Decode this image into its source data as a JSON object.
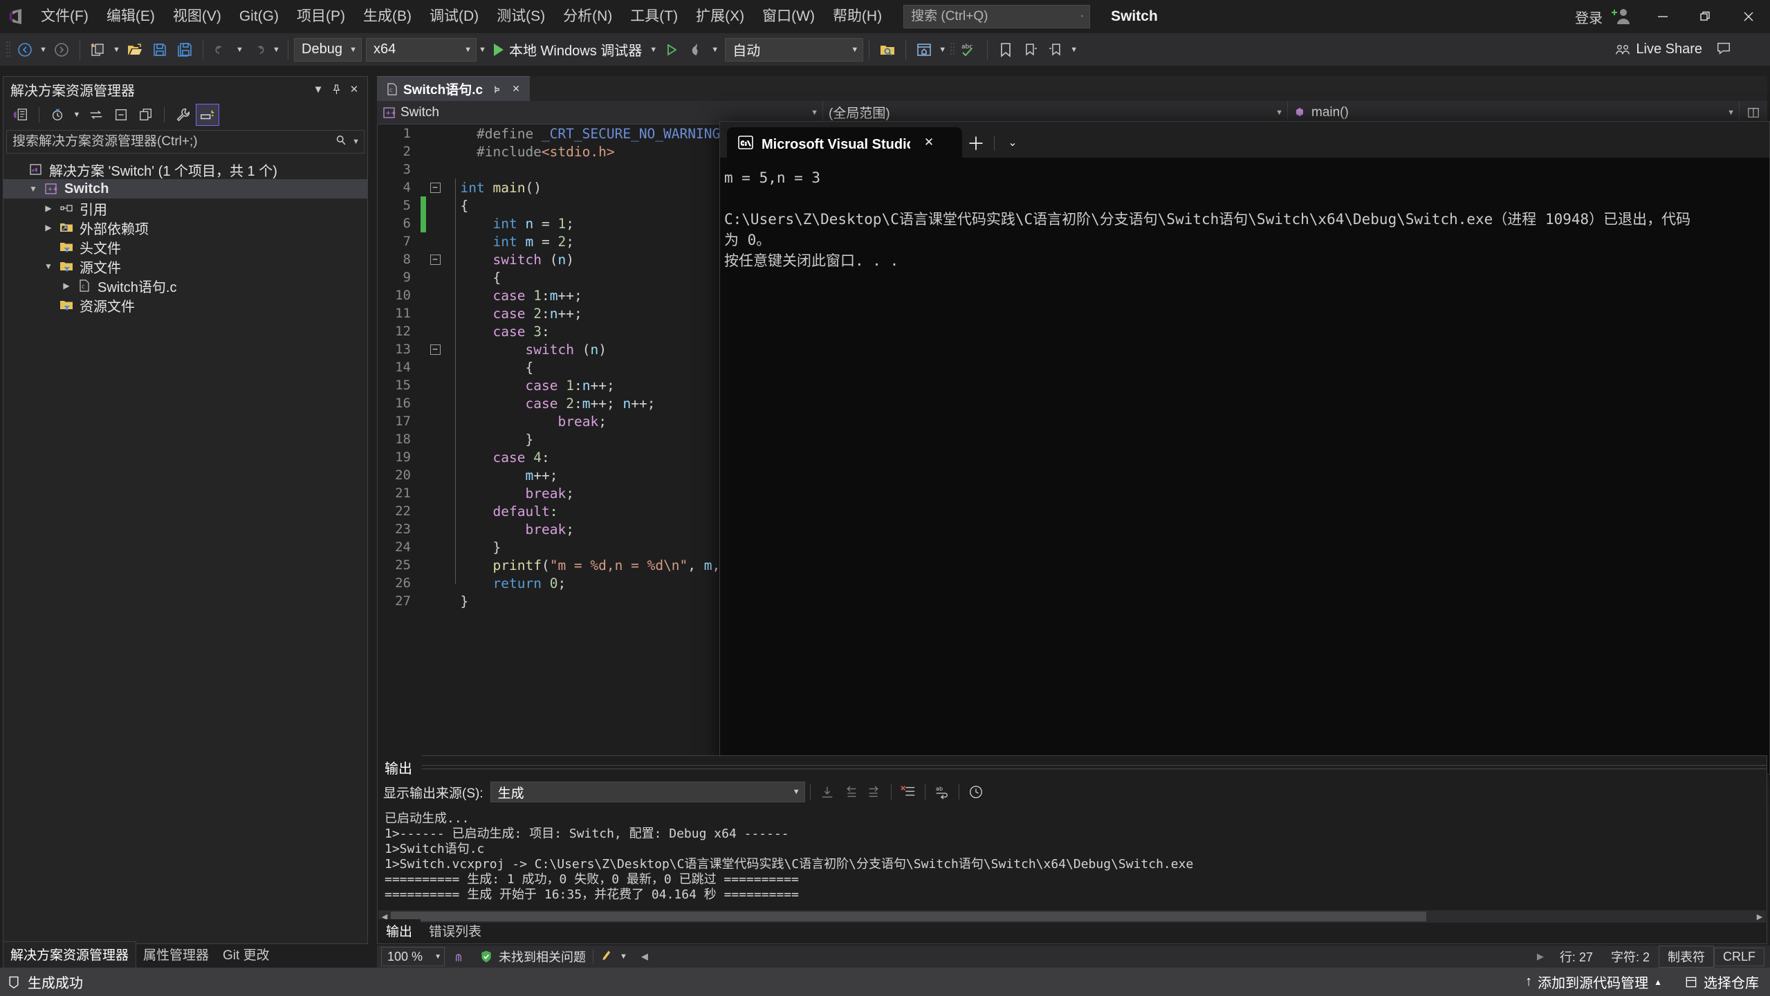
{
  "titlebar": {
    "menus": [
      "文件(F)",
      "编辑(E)",
      "视图(V)",
      "Git(G)",
      "项目(P)",
      "生成(B)",
      "调试(D)",
      "测试(S)",
      "分析(N)",
      "工具(T)",
      "扩展(X)",
      "窗口(W)",
      "帮助(H)"
    ],
    "search_placeholder": "搜索 (Ctrl+Q)",
    "solution_name": "Switch",
    "signin_label": "登录",
    "minimize": "—",
    "maximize": "❐",
    "close": "✕"
  },
  "toolbar": {
    "configuration": "Debug",
    "platform": "x64",
    "run_label": "本地 Windows 调试器",
    "auto_label": "自动",
    "live_share": "Live Share"
  },
  "solution_explorer": {
    "title": "解决方案资源管理器",
    "search_placeholder": "搜索解决方案资源管理器(Ctrl+;)",
    "tree": [
      {
        "label": "解决方案 'Switch' (1 个项目，共 1 个)",
        "indent": 0,
        "twisty": "",
        "icon": "solution-icon",
        "bold": false,
        "selected": false
      },
      {
        "label": "Switch",
        "indent": 1,
        "twisty": "▼",
        "icon": "cpp-project-icon",
        "bold": true,
        "selected": true
      },
      {
        "label": "引用",
        "indent": 2,
        "twisty": "▶",
        "icon": "references-icon",
        "bold": false,
        "selected": false
      },
      {
        "label": "外部依赖项",
        "indent": 2,
        "twisty": "▶",
        "icon": "external-deps-icon",
        "bold": false,
        "selected": false
      },
      {
        "label": "头文件",
        "indent": 2,
        "twisty": "",
        "icon": "filter-folder-icon",
        "bold": false,
        "selected": false
      },
      {
        "label": "源文件",
        "indent": 2,
        "twisty": "▼",
        "icon": "filter-folder-icon",
        "bold": false,
        "selected": false
      },
      {
        "label": "Switch语句.c",
        "indent": 3,
        "twisty": "▶",
        "icon": "c-file-icon",
        "bold": false,
        "selected": false
      },
      {
        "label": "资源文件",
        "indent": 2,
        "twisty": "",
        "icon": "filter-folder-icon",
        "bold": false,
        "selected": false
      }
    ],
    "bottom_tabs": [
      {
        "label": "解决方案资源管理器",
        "active": true
      },
      {
        "label": "属性管理器",
        "active": false
      },
      {
        "label": "Git 更改",
        "active": false
      }
    ]
  },
  "editor": {
    "tab_label": "Switch语句.c",
    "nav_project": "Switch",
    "nav_scope": "(全局范围)",
    "nav_member": "main()",
    "lines": [
      {
        "n": 1,
        "fold": "",
        "mark": "",
        "text": "    #define _CRT_SECURE_NO_WARNINGS"
      },
      {
        "n": 2,
        "fold": "",
        "mark": "",
        "text": "    #include<stdio.h>"
      },
      {
        "n": 3,
        "fold": "",
        "mark": "",
        "text": ""
      },
      {
        "n": 4,
        "fold": "-",
        "mark": "",
        "text": "  int main()"
      },
      {
        "n": 5,
        "fold": "",
        "mark": "green",
        "text": "  {"
      },
      {
        "n": 6,
        "fold": "",
        "mark": "green",
        "text": "      int n = 1;"
      },
      {
        "n": 7,
        "fold": "",
        "mark": "",
        "text": "      int m = 2;"
      },
      {
        "n": 8,
        "fold": "-",
        "mark": "",
        "text": "      switch (n)"
      },
      {
        "n": 9,
        "fold": "",
        "mark": "",
        "text": "      {"
      },
      {
        "n": 10,
        "fold": "",
        "mark": "",
        "text": "      case 1:m++;"
      },
      {
        "n": 11,
        "fold": "",
        "mark": "",
        "text": "      case 2:n++;"
      },
      {
        "n": 12,
        "fold": "",
        "mark": "",
        "text": "      case 3:"
      },
      {
        "n": 13,
        "fold": "-",
        "mark": "",
        "text": "          switch (n)"
      },
      {
        "n": 14,
        "fold": "",
        "mark": "",
        "text": "          {"
      },
      {
        "n": 15,
        "fold": "",
        "mark": "",
        "text": "          case 1:n++;"
      },
      {
        "n": 16,
        "fold": "",
        "mark": "",
        "text": "          case 2:m++; n++;"
      },
      {
        "n": 17,
        "fold": "",
        "mark": "",
        "text": "              break;"
      },
      {
        "n": 18,
        "fold": "",
        "mark": "",
        "text": "          }"
      },
      {
        "n": 19,
        "fold": "",
        "mark": "",
        "text": "      case 4:"
      },
      {
        "n": 20,
        "fold": "",
        "mark": "",
        "text": "          m++;"
      },
      {
        "n": 21,
        "fold": "",
        "mark": "",
        "text": "          break;"
      },
      {
        "n": 22,
        "fold": "",
        "mark": "",
        "text": "      default:"
      },
      {
        "n": 23,
        "fold": "",
        "mark": "",
        "text": "          break;"
      },
      {
        "n": 24,
        "fold": "",
        "mark": "",
        "text": "      }"
      },
      {
        "n": 25,
        "fold": "",
        "mark": "",
        "text": "      printf(\"m = %d,n = %d\\n\", m, n);"
      },
      {
        "n": 26,
        "fold": "",
        "mark": "",
        "text": "      return 0;"
      },
      {
        "n": 27,
        "fold": "",
        "mark": "",
        "text": "  }"
      }
    ],
    "status": {
      "zoom": "100 %",
      "issues": "未找到相关问题",
      "line": "行: 27",
      "col": "字符: 2",
      "tabs": "制表符",
      "eol": "CRLF"
    }
  },
  "console": {
    "tab_title": "Microsoft Visual Studio 调试控",
    "close": "✕",
    "new_tab": "＋",
    "dropdown": "⌄",
    "output": "m = 5,n = 3\n\nC:\\Users\\Z\\Desktop\\C语言课堂代码实践\\C语言初阶\\分支语句\\Switch语句\\Switch\\x64\\Debug\\Switch.exe（进程 10948）已退出，代码\n为 0。\n按任意键关闭此窗口. . ."
  },
  "output_panel": {
    "title": "输出",
    "source_label": "显示输出来源(S):",
    "source_value": "生成",
    "text": "已启动生成...\n1>------ 已启动生成: 项目: Switch, 配置: Debug x64 ------\n1>Switch语句.c\n1>Switch.vcxproj -> C:\\Users\\Z\\Desktop\\C语言课堂代码实践\\C语言初阶\\分支语句\\Switch语句\\Switch\\x64\\Debug\\Switch.exe\n========== 生成: 1 成功，0 失败，0 最新，0 已跳过 ==========\n========== 生成 开始于 16:35，并花费了 04.164 秒 ==========",
    "tabs": [
      {
        "label": "输出",
        "active": true
      },
      {
        "label": "错误列表",
        "active": false
      }
    ]
  },
  "statusbar": {
    "build_status": "生成成功",
    "source_control": "添加到源代码管理",
    "repo": "选择仓库",
    "caret_up": "▲",
    "arrow_up": "↑"
  },
  "colors": {
    "accent_blue": "#007acc",
    "status_bar": "#3d3d40",
    "green_marker": "#4caf50",
    "purple_highlight": "#7b61ff"
  }
}
